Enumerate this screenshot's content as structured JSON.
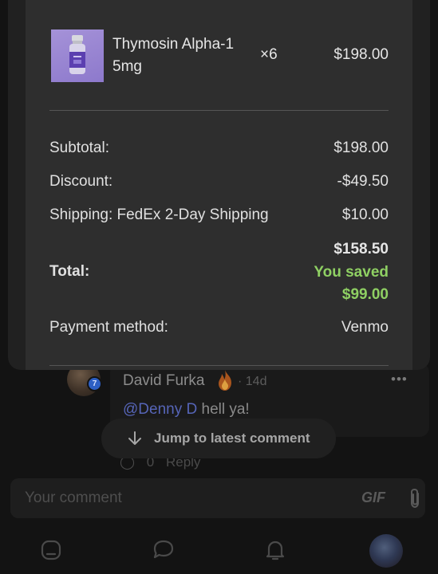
{
  "order": {
    "item": {
      "name": "Thymosin Alpha-1 5mg",
      "quantity": "×6",
      "price": "$198.00"
    },
    "subtotal_label": "Subtotal:",
    "subtotal_value": "$198.00",
    "discount_label": "Discount:",
    "discount_value": "-$49.50",
    "shipping_label": "Shipping: FedEx 2-Day Shipping",
    "shipping_value": "$10.00",
    "total_label": "Total:",
    "total_value": "$158.50",
    "saved_line1": "You saved",
    "saved_line2": "$99.00",
    "payment_label": "Payment method:",
    "payment_value": "Venmo"
  },
  "comment": {
    "author": "David Furka",
    "time": "· 14d",
    "mention": "@Denny D",
    "text": " hell ya!",
    "avatar_badge": "7",
    "reply_count": "0",
    "reply_label": "Reply"
  },
  "jump_label": "Jump to latest comment",
  "composer": {
    "placeholder": "Your comment",
    "gif_label": "GIF"
  },
  "nav": [
    "home-icon",
    "chat-icon",
    "bell-icon",
    "profile-avatar"
  ],
  "colors": {
    "saved_green": "#8fd063",
    "mention_blue": "#5665b8",
    "sheet_bg": "#2e2e2e"
  }
}
